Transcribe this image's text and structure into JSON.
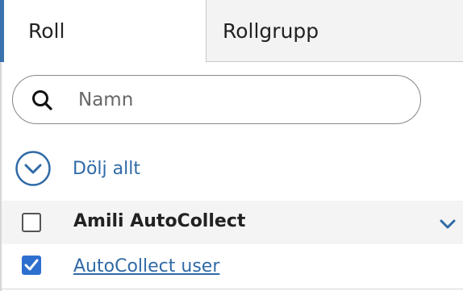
{
  "tabs": [
    {
      "label": "Roll",
      "active": true
    },
    {
      "label": "Rollgrupp",
      "active": false
    }
  ],
  "search": {
    "placeholder": "Namn",
    "value": "",
    "icon": "search-icon"
  },
  "collapse": {
    "label": "Dölj allt",
    "icon": "chevron-down-circle-icon"
  },
  "tree": {
    "group": {
      "label": "Amili AutoCollect",
      "checked": false,
      "expanded": true
    },
    "items": [
      {
        "label": "AutoCollect user",
        "checked": true
      }
    ]
  },
  "colors": {
    "accent": "#3a72ad",
    "link": "#2f6aa6",
    "checkbox": "#2d6fcf"
  }
}
